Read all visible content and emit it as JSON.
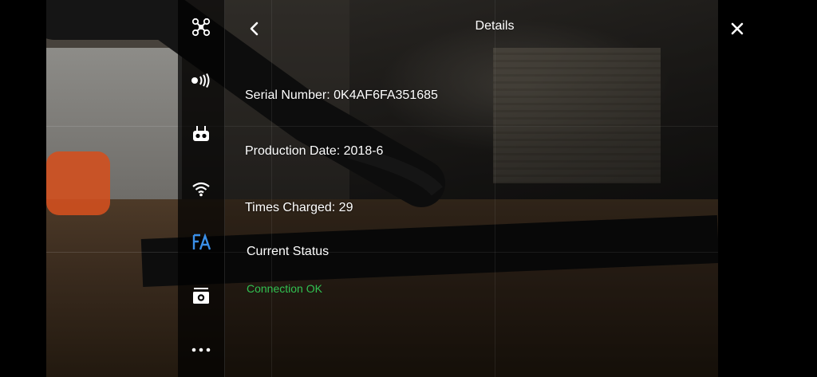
{
  "details": {
    "title": "Details",
    "serial_number": "Serial Number: 0K4AF6FA351685",
    "production_date": "Production Date: 2018-6",
    "times_charged": "Times Charged: 29",
    "current_status_label": "Current Status",
    "connection_status": "Connection OK"
  },
  "sidebar": {
    "items": [
      {
        "icon": "aircraft-icon"
      },
      {
        "icon": "signal-transmission-icon"
      },
      {
        "icon": "remote-controller-icon"
      },
      {
        "icon": "wifi-icon"
      },
      {
        "icon": "fa-brand-icon",
        "active": true
      },
      {
        "icon": "camera-icon"
      },
      {
        "icon": "more-icon"
      }
    ]
  },
  "colors": {
    "status_ok": "#31c151",
    "active_icon": "#3a8fe8"
  }
}
